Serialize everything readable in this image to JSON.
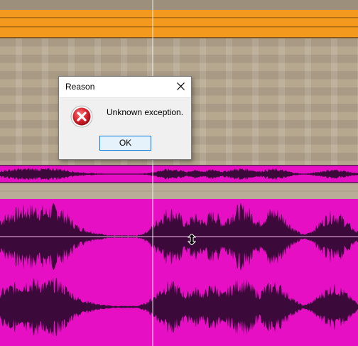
{
  "dialog": {
    "title": "Reason",
    "message": "Unknown exception.",
    "ok_label": "OK",
    "icon": "error-icon",
    "close_icon": "close-icon"
  },
  "colors": {
    "arrangement_bg": "#a89a84",
    "lane_orange": "#f39a1e",
    "audio_clip": "#e70fc4",
    "waveform": "#3c0a3a",
    "error_red": "#d9232e"
  },
  "cursor": {
    "icon": "vertical-resize-cursor-icon"
  }
}
